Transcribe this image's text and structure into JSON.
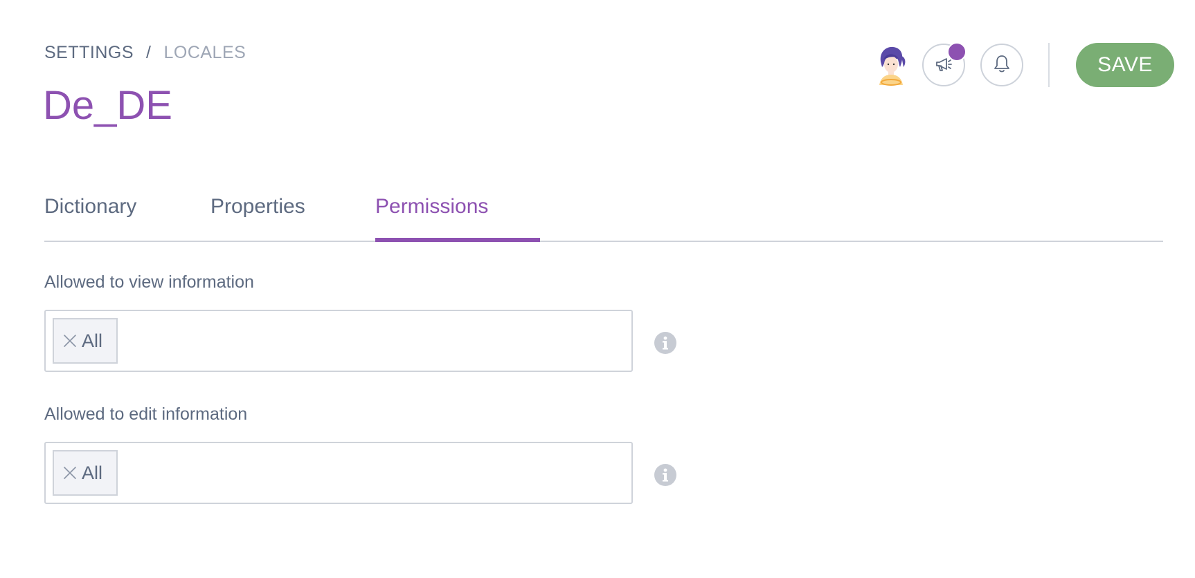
{
  "breadcrumb": {
    "root": "SETTINGS",
    "separator": "/",
    "current": "LOCALES"
  },
  "page": {
    "title": "De_DE"
  },
  "header_actions": {
    "avatar_icon": "user-avatar-icon",
    "announcements_icon": "megaphone-icon",
    "announcements_has_unread": true,
    "notifications_icon": "bell-icon",
    "save_label": "SAVE"
  },
  "tabs": [
    {
      "label": "Dictionary",
      "active": false
    },
    {
      "label": "Properties",
      "active": false
    },
    {
      "label": "Permissions",
      "active": true
    }
  ],
  "permissions": {
    "view": {
      "label": "Allowed to view information",
      "tags": [
        {
          "label": "All"
        }
      ],
      "info_icon": "info-icon"
    },
    "edit": {
      "label": "Allowed to edit information",
      "tags": [
        {
          "label": "All"
        }
      ],
      "info_icon": "info-icon"
    }
  },
  "colors": {
    "accent": "#8d51b1",
    "save": "#7aae74",
    "text": "#5d6a80",
    "muted": "#9ea6b5",
    "border": "#cfd3da"
  }
}
